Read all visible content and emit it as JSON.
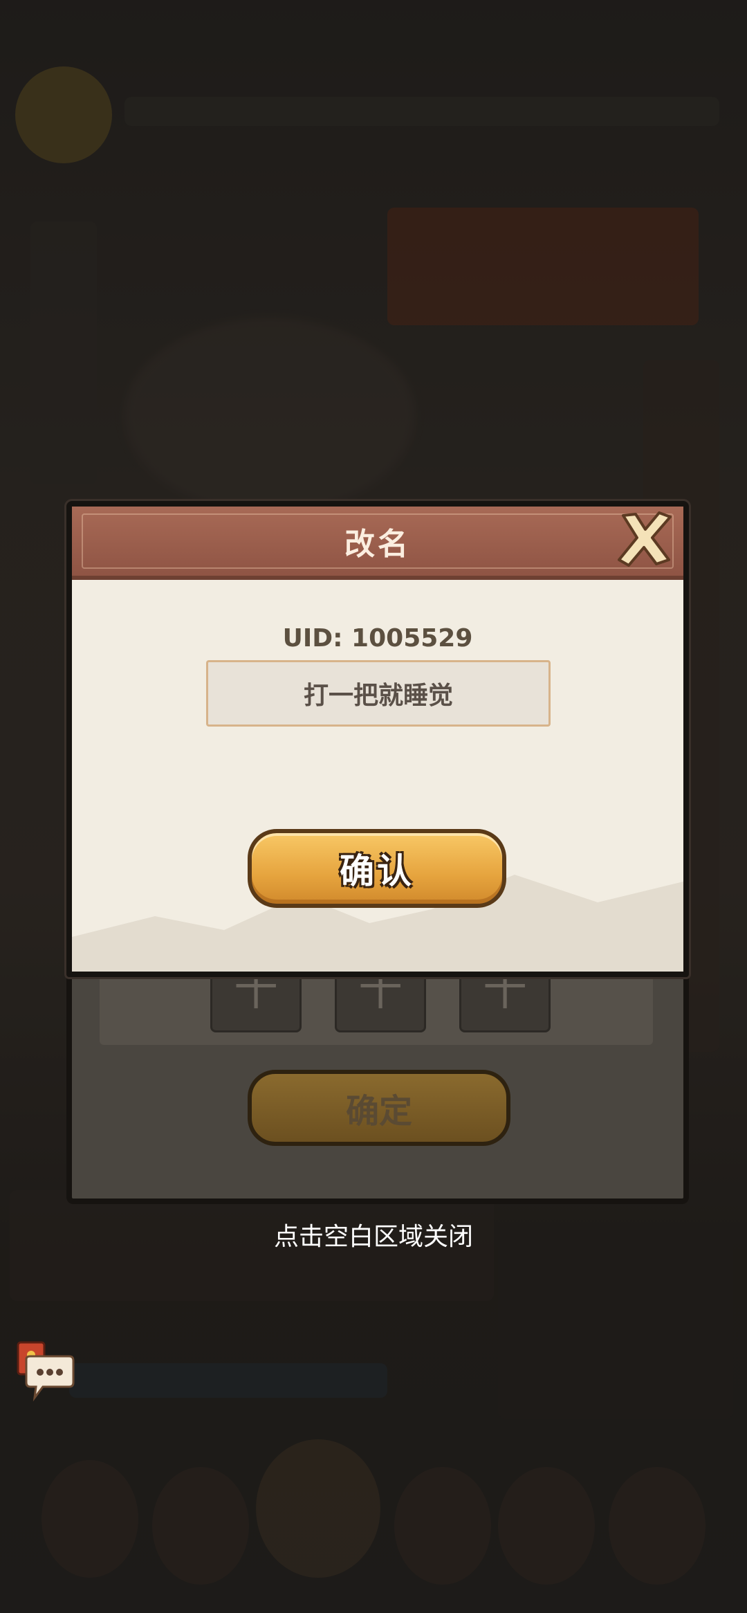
{
  "dialog": {
    "title": "改名",
    "uid_text": "UID: 1005529",
    "name_value": "打一把就睡觉",
    "confirm_label": "确认"
  },
  "back_dialog": {
    "confirm_label": "确定",
    "slot_symbol": "十"
  },
  "hint": {
    "close_text": "点击空白区域关闭"
  },
  "icons": {
    "close": "close-x-icon",
    "chat": "chat-bubble-icon",
    "red_envelope": "red-envelope-icon"
  },
  "colors": {
    "header": "#9c5e4c",
    "dialog_bg": "#f2ede2",
    "confirm_gold": "#e6a43e",
    "overlay": "rgba(10,8,6,0.45)"
  }
}
